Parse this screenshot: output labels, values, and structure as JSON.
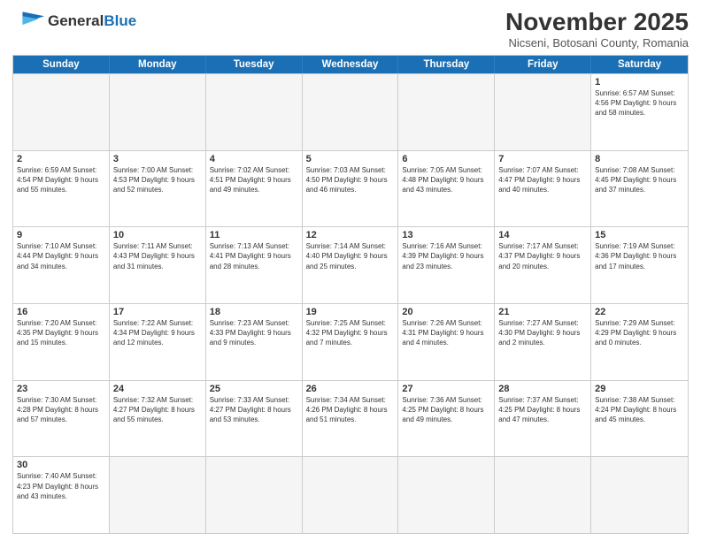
{
  "header": {
    "logo_general": "General",
    "logo_blue": "Blue",
    "month_title": "November 2025",
    "location": "Nicseni, Botosani County, Romania"
  },
  "weekdays": [
    "Sunday",
    "Monday",
    "Tuesday",
    "Wednesday",
    "Thursday",
    "Friday",
    "Saturday"
  ],
  "rows": [
    [
      {
        "day": "",
        "info": "",
        "empty": true
      },
      {
        "day": "",
        "info": "",
        "empty": true
      },
      {
        "day": "",
        "info": "",
        "empty": true
      },
      {
        "day": "",
        "info": "",
        "empty": true
      },
      {
        "day": "",
        "info": "",
        "empty": true
      },
      {
        "day": "",
        "info": "",
        "empty": true
      },
      {
        "day": "1",
        "info": "Sunrise: 6:57 AM\nSunset: 4:56 PM\nDaylight: 9 hours\nand 58 minutes.",
        "empty": false
      }
    ],
    [
      {
        "day": "2",
        "info": "Sunrise: 6:59 AM\nSunset: 4:54 PM\nDaylight: 9 hours\nand 55 minutes.",
        "empty": false
      },
      {
        "day": "3",
        "info": "Sunrise: 7:00 AM\nSunset: 4:53 PM\nDaylight: 9 hours\nand 52 minutes.",
        "empty": false
      },
      {
        "day": "4",
        "info": "Sunrise: 7:02 AM\nSunset: 4:51 PM\nDaylight: 9 hours\nand 49 minutes.",
        "empty": false
      },
      {
        "day": "5",
        "info": "Sunrise: 7:03 AM\nSunset: 4:50 PM\nDaylight: 9 hours\nand 46 minutes.",
        "empty": false
      },
      {
        "day": "6",
        "info": "Sunrise: 7:05 AM\nSunset: 4:48 PM\nDaylight: 9 hours\nand 43 minutes.",
        "empty": false
      },
      {
        "day": "7",
        "info": "Sunrise: 7:07 AM\nSunset: 4:47 PM\nDaylight: 9 hours\nand 40 minutes.",
        "empty": false
      },
      {
        "day": "8",
        "info": "Sunrise: 7:08 AM\nSunset: 4:45 PM\nDaylight: 9 hours\nand 37 minutes.",
        "empty": false
      }
    ],
    [
      {
        "day": "9",
        "info": "Sunrise: 7:10 AM\nSunset: 4:44 PM\nDaylight: 9 hours\nand 34 minutes.",
        "empty": false
      },
      {
        "day": "10",
        "info": "Sunrise: 7:11 AM\nSunset: 4:43 PM\nDaylight: 9 hours\nand 31 minutes.",
        "empty": false
      },
      {
        "day": "11",
        "info": "Sunrise: 7:13 AM\nSunset: 4:41 PM\nDaylight: 9 hours\nand 28 minutes.",
        "empty": false
      },
      {
        "day": "12",
        "info": "Sunrise: 7:14 AM\nSunset: 4:40 PM\nDaylight: 9 hours\nand 25 minutes.",
        "empty": false
      },
      {
        "day": "13",
        "info": "Sunrise: 7:16 AM\nSunset: 4:39 PM\nDaylight: 9 hours\nand 23 minutes.",
        "empty": false
      },
      {
        "day": "14",
        "info": "Sunrise: 7:17 AM\nSunset: 4:37 PM\nDaylight: 9 hours\nand 20 minutes.",
        "empty": false
      },
      {
        "day": "15",
        "info": "Sunrise: 7:19 AM\nSunset: 4:36 PM\nDaylight: 9 hours\nand 17 minutes.",
        "empty": false
      }
    ],
    [
      {
        "day": "16",
        "info": "Sunrise: 7:20 AM\nSunset: 4:35 PM\nDaylight: 9 hours\nand 15 minutes.",
        "empty": false
      },
      {
        "day": "17",
        "info": "Sunrise: 7:22 AM\nSunset: 4:34 PM\nDaylight: 9 hours\nand 12 minutes.",
        "empty": false
      },
      {
        "day": "18",
        "info": "Sunrise: 7:23 AM\nSunset: 4:33 PM\nDaylight: 9 hours\nand 9 minutes.",
        "empty": false
      },
      {
        "day": "19",
        "info": "Sunrise: 7:25 AM\nSunset: 4:32 PM\nDaylight: 9 hours\nand 7 minutes.",
        "empty": false
      },
      {
        "day": "20",
        "info": "Sunrise: 7:26 AM\nSunset: 4:31 PM\nDaylight: 9 hours\nand 4 minutes.",
        "empty": false
      },
      {
        "day": "21",
        "info": "Sunrise: 7:27 AM\nSunset: 4:30 PM\nDaylight: 9 hours\nand 2 minutes.",
        "empty": false
      },
      {
        "day": "22",
        "info": "Sunrise: 7:29 AM\nSunset: 4:29 PM\nDaylight: 9 hours\nand 0 minutes.",
        "empty": false
      }
    ],
    [
      {
        "day": "23",
        "info": "Sunrise: 7:30 AM\nSunset: 4:28 PM\nDaylight: 8 hours\nand 57 minutes.",
        "empty": false
      },
      {
        "day": "24",
        "info": "Sunrise: 7:32 AM\nSunset: 4:27 PM\nDaylight: 8 hours\nand 55 minutes.",
        "empty": false
      },
      {
        "day": "25",
        "info": "Sunrise: 7:33 AM\nSunset: 4:27 PM\nDaylight: 8 hours\nand 53 minutes.",
        "empty": false
      },
      {
        "day": "26",
        "info": "Sunrise: 7:34 AM\nSunset: 4:26 PM\nDaylight: 8 hours\nand 51 minutes.",
        "empty": false
      },
      {
        "day": "27",
        "info": "Sunrise: 7:36 AM\nSunset: 4:25 PM\nDaylight: 8 hours\nand 49 minutes.",
        "empty": false
      },
      {
        "day": "28",
        "info": "Sunrise: 7:37 AM\nSunset: 4:25 PM\nDaylight: 8 hours\nand 47 minutes.",
        "empty": false
      },
      {
        "day": "29",
        "info": "Sunrise: 7:38 AM\nSunset: 4:24 PM\nDaylight: 8 hours\nand 45 minutes.",
        "empty": false
      }
    ],
    [
      {
        "day": "30",
        "info": "Sunrise: 7:40 AM\nSunset: 4:23 PM\nDaylight: 8 hours\nand 43 minutes.",
        "empty": false
      },
      {
        "day": "",
        "info": "",
        "empty": true
      },
      {
        "day": "",
        "info": "",
        "empty": true
      },
      {
        "day": "",
        "info": "",
        "empty": true
      },
      {
        "day": "",
        "info": "",
        "empty": true
      },
      {
        "day": "",
        "info": "",
        "empty": true
      },
      {
        "day": "",
        "info": "",
        "empty": true
      }
    ]
  ]
}
